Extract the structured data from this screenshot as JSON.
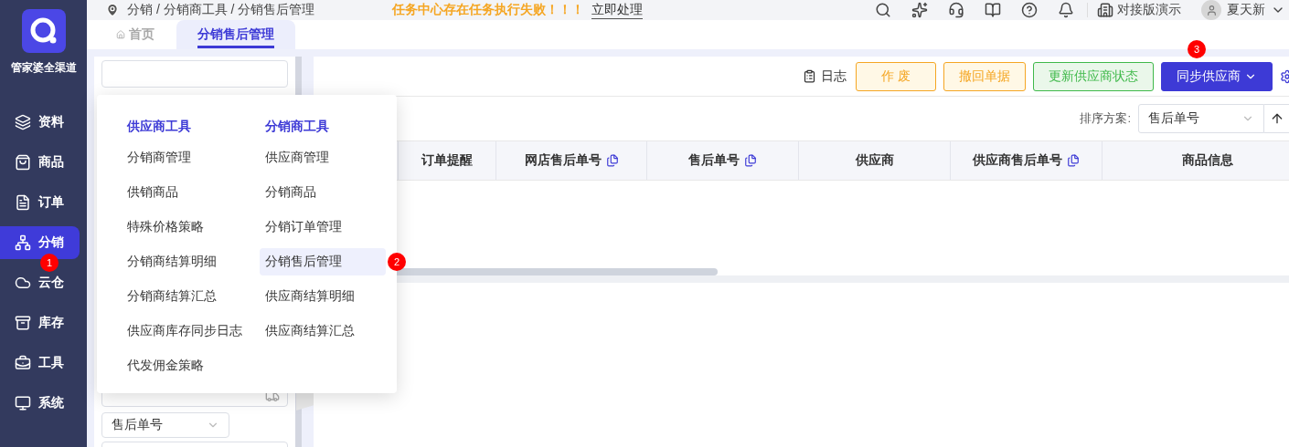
{
  "sidebar": {
    "brand": "管家婆全渠道",
    "items": [
      {
        "label": "资料",
        "selected": false
      },
      {
        "label": "商品",
        "selected": false
      },
      {
        "label": "订单",
        "selected": false
      },
      {
        "label": "分销",
        "selected": true,
        "badge": "1"
      },
      {
        "label": "云仓",
        "selected": false
      },
      {
        "label": "库存",
        "selected": false
      },
      {
        "label": "工具",
        "selected": false
      },
      {
        "label": "系统",
        "selected": false
      }
    ]
  },
  "breadcrumb": "分销 / 分销商工具 / 分销售后管理",
  "notice": {
    "text": "任务中心存在任务执行失败！！！",
    "action": "立即处理"
  },
  "account": {
    "org": "对接版演示",
    "user": "夏天新"
  },
  "tabs": [
    {
      "label": "首页",
      "selected": false
    },
    {
      "label": "分销售后管理",
      "selected": true
    }
  ],
  "filter_panel": {
    "select": "售后单号"
  },
  "toolbar": {
    "log": "日志",
    "buttons": [
      {
        "label": "作 废",
        "kind": "warning"
      },
      {
        "label": "撤回单据",
        "kind": "warning"
      },
      {
        "label": "更新供应商状态",
        "kind": "success"
      },
      {
        "label": "同步供应商",
        "kind": "primary",
        "badge": "3"
      }
    ]
  },
  "sort": {
    "label": "排序方案:",
    "value": "售后单号"
  },
  "table": {
    "columns": [
      {
        "label": "订单提醒",
        "copyable": false
      },
      {
        "label": "网店售后单号",
        "copyable": true
      },
      {
        "label": "售后单号",
        "copyable": true
      },
      {
        "label": "供应商",
        "copyable": false
      },
      {
        "label": "供应商售后单号",
        "copyable": true
      },
      {
        "label": "商品信息",
        "copyable": false
      }
    ]
  },
  "menu": {
    "columns": [
      {
        "title": "供应商工具",
        "items": [
          {
            "label": "分销商管理",
            "selected": false
          },
          {
            "label": "供销商品",
            "selected": false
          },
          {
            "label": "特殊价格策略",
            "selected": false
          },
          {
            "label": "分销商结算明细",
            "selected": false
          },
          {
            "label": "分销商结算汇总",
            "selected": false
          },
          {
            "label": "供应商库存同步日志",
            "selected": false
          },
          {
            "label": "代发佣金策略",
            "selected": false
          }
        ]
      },
      {
        "title": "分销商工具",
        "items": [
          {
            "label": "供应商管理",
            "selected": false
          },
          {
            "label": "分销商品",
            "selected": false
          },
          {
            "label": "分销订单管理",
            "selected": false
          },
          {
            "label": "分销售后管理",
            "selected": true,
            "badge": "2"
          },
          {
            "label": "供应商结算明细",
            "selected": false
          },
          {
            "label": "供应商结算汇总",
            "selected": false
          }
        ]
      }
    ]
  }
}
